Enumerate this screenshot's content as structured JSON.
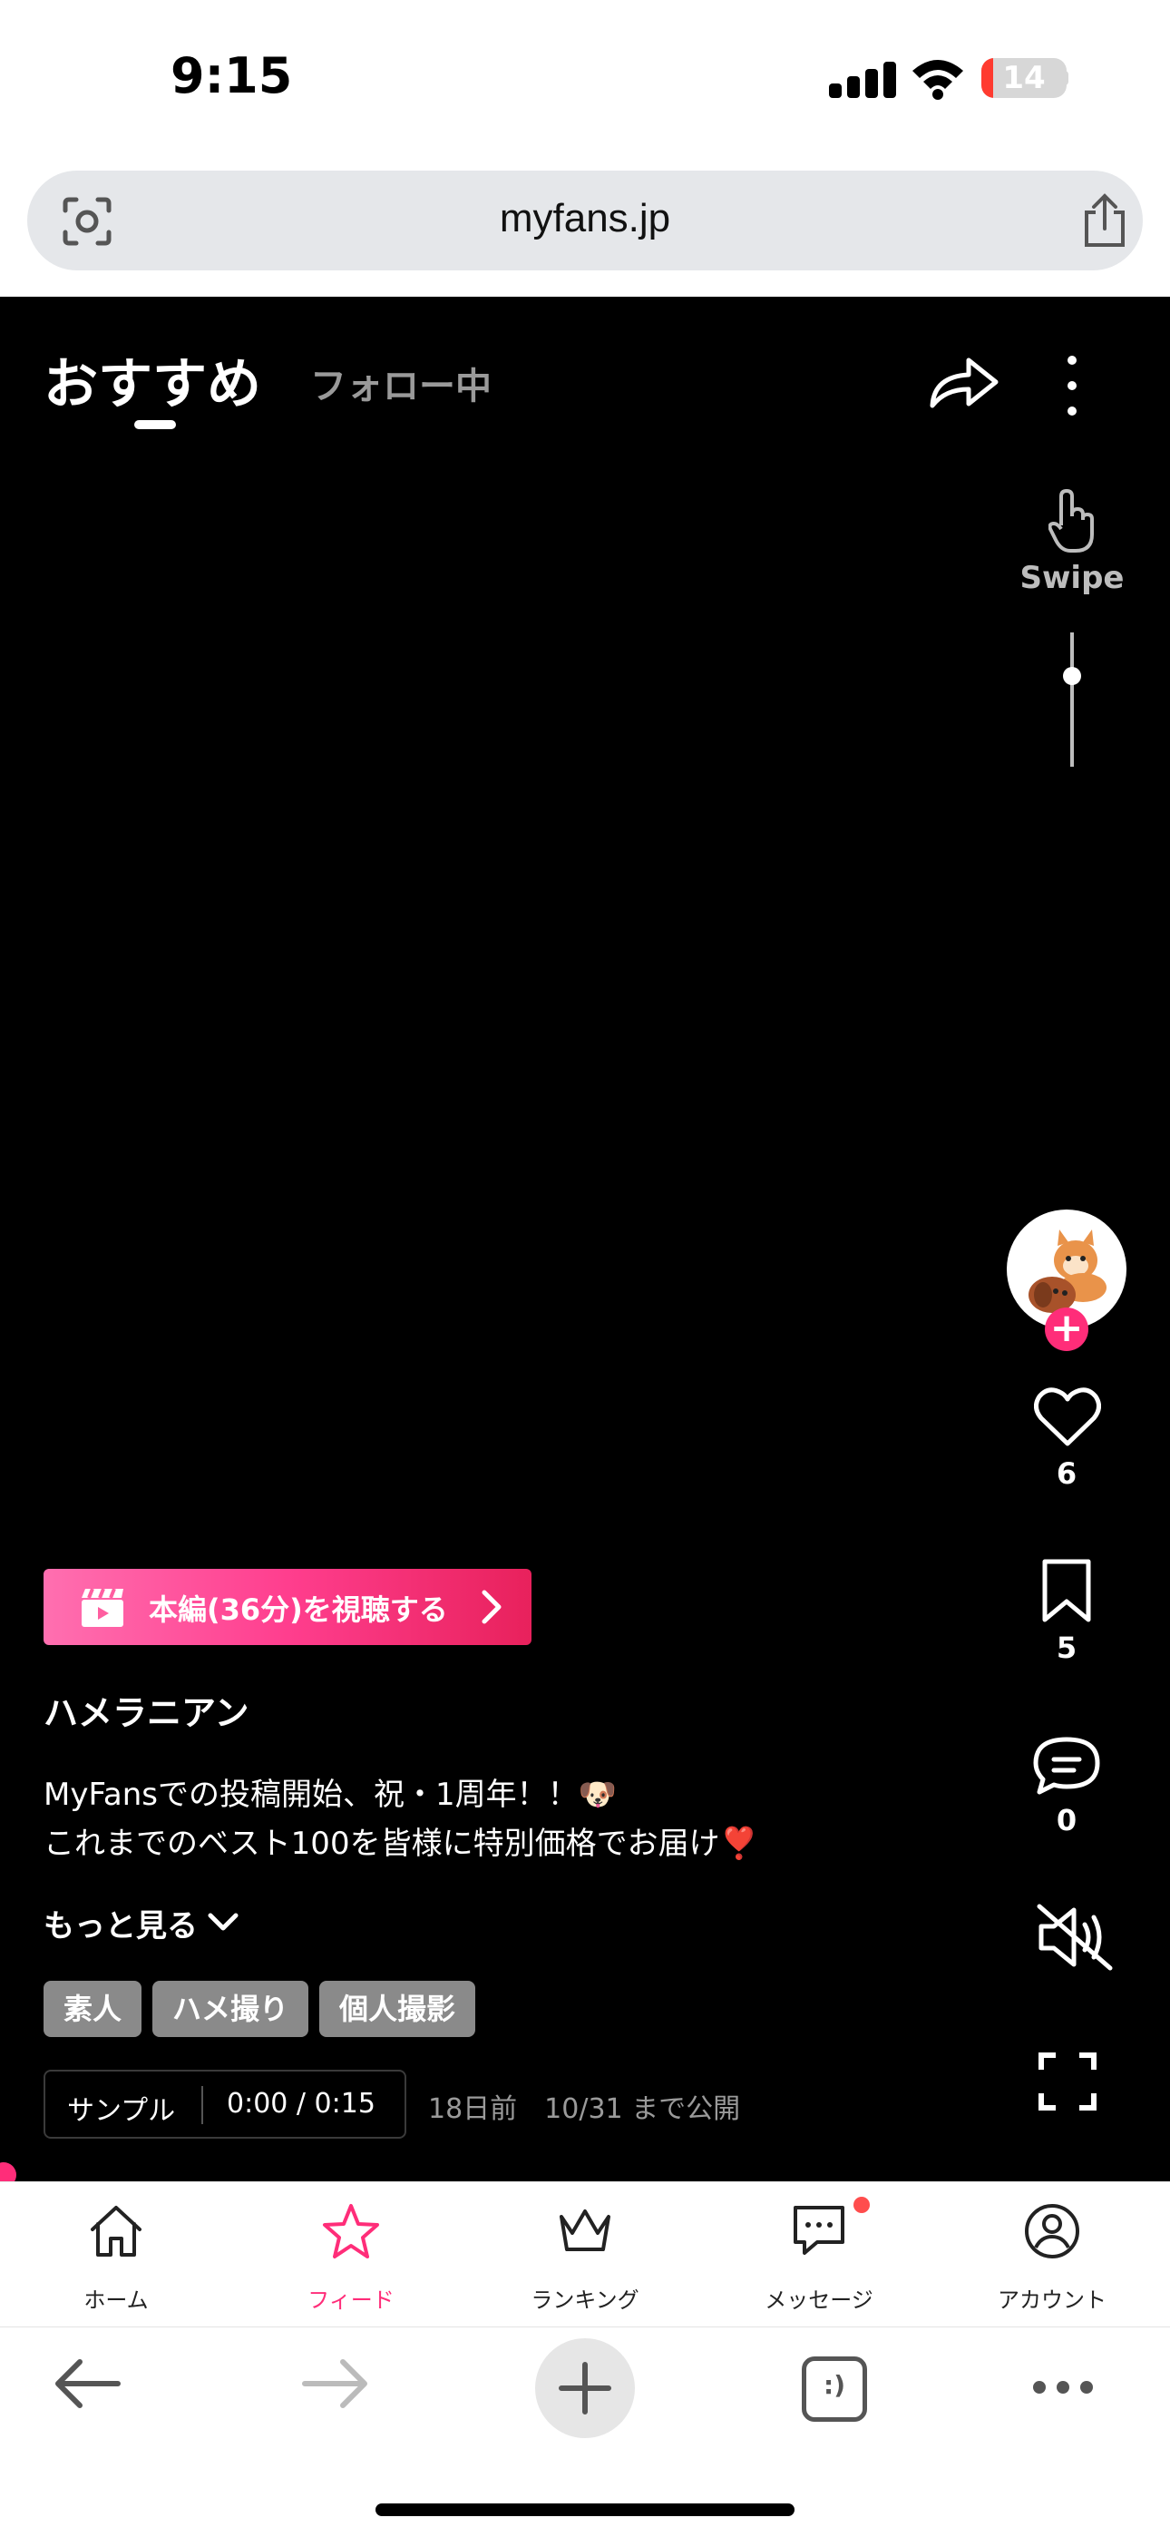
{
  "status": {
    "time": "9:15",
    "battery": "14",
    "battery_level": 0.14
  },
  "browser": {
    "url": "myfans.jp"
  },
  "header": {
    "tab_recommended": "おすすめ",
    "tab_following": "フォロー中"
  },
  "swipe": {
    "label": "Swipe"
  },
  "actions": {
    "likes": "6",
    "bookmarks": "5",
    "comments": "0"
  },
  "post": {
    "cta_label": "本編(36分)を視聴する",
    "creator": "ハメラニアン",
    "desc_line1": "MyFansでの投稿開始、祝・1周年！！🐶",
    "desc_line2": "これまでのベスト100を皆様に特別価格でお届け❣️",
    "more_label": "もっと見る",
    "tags": [
      "素人",
      "ハメ撮り",
      "個人撮影"
    ],
    "sample_label": "サンプル",
    "sample_time": "0:00 / 0:15",
    "meta": "18日前　10/31 まで公開"
  },
  "tabbar": {
    "items": [
      {
        "label": "ホーム",
        "icon": "home-icon"
      },
      {
        "label": "フィード",
        "icon": "star-icon"
      },
      {
        "label": "ランキング",
        "icon": "crown-icon"
      },
      {
        "label": "メッセージ",
        "icon": "message-icon"
      },
      {
        "label": "アカウント",
        "icon": "account-icon"
      }
    ]
  },
  "toolbar": {
    "tabs_glyph": ":)"
  },
  "colors": {
    "accent": "#ff2d79",
    "background": "#000000"
  }
}
